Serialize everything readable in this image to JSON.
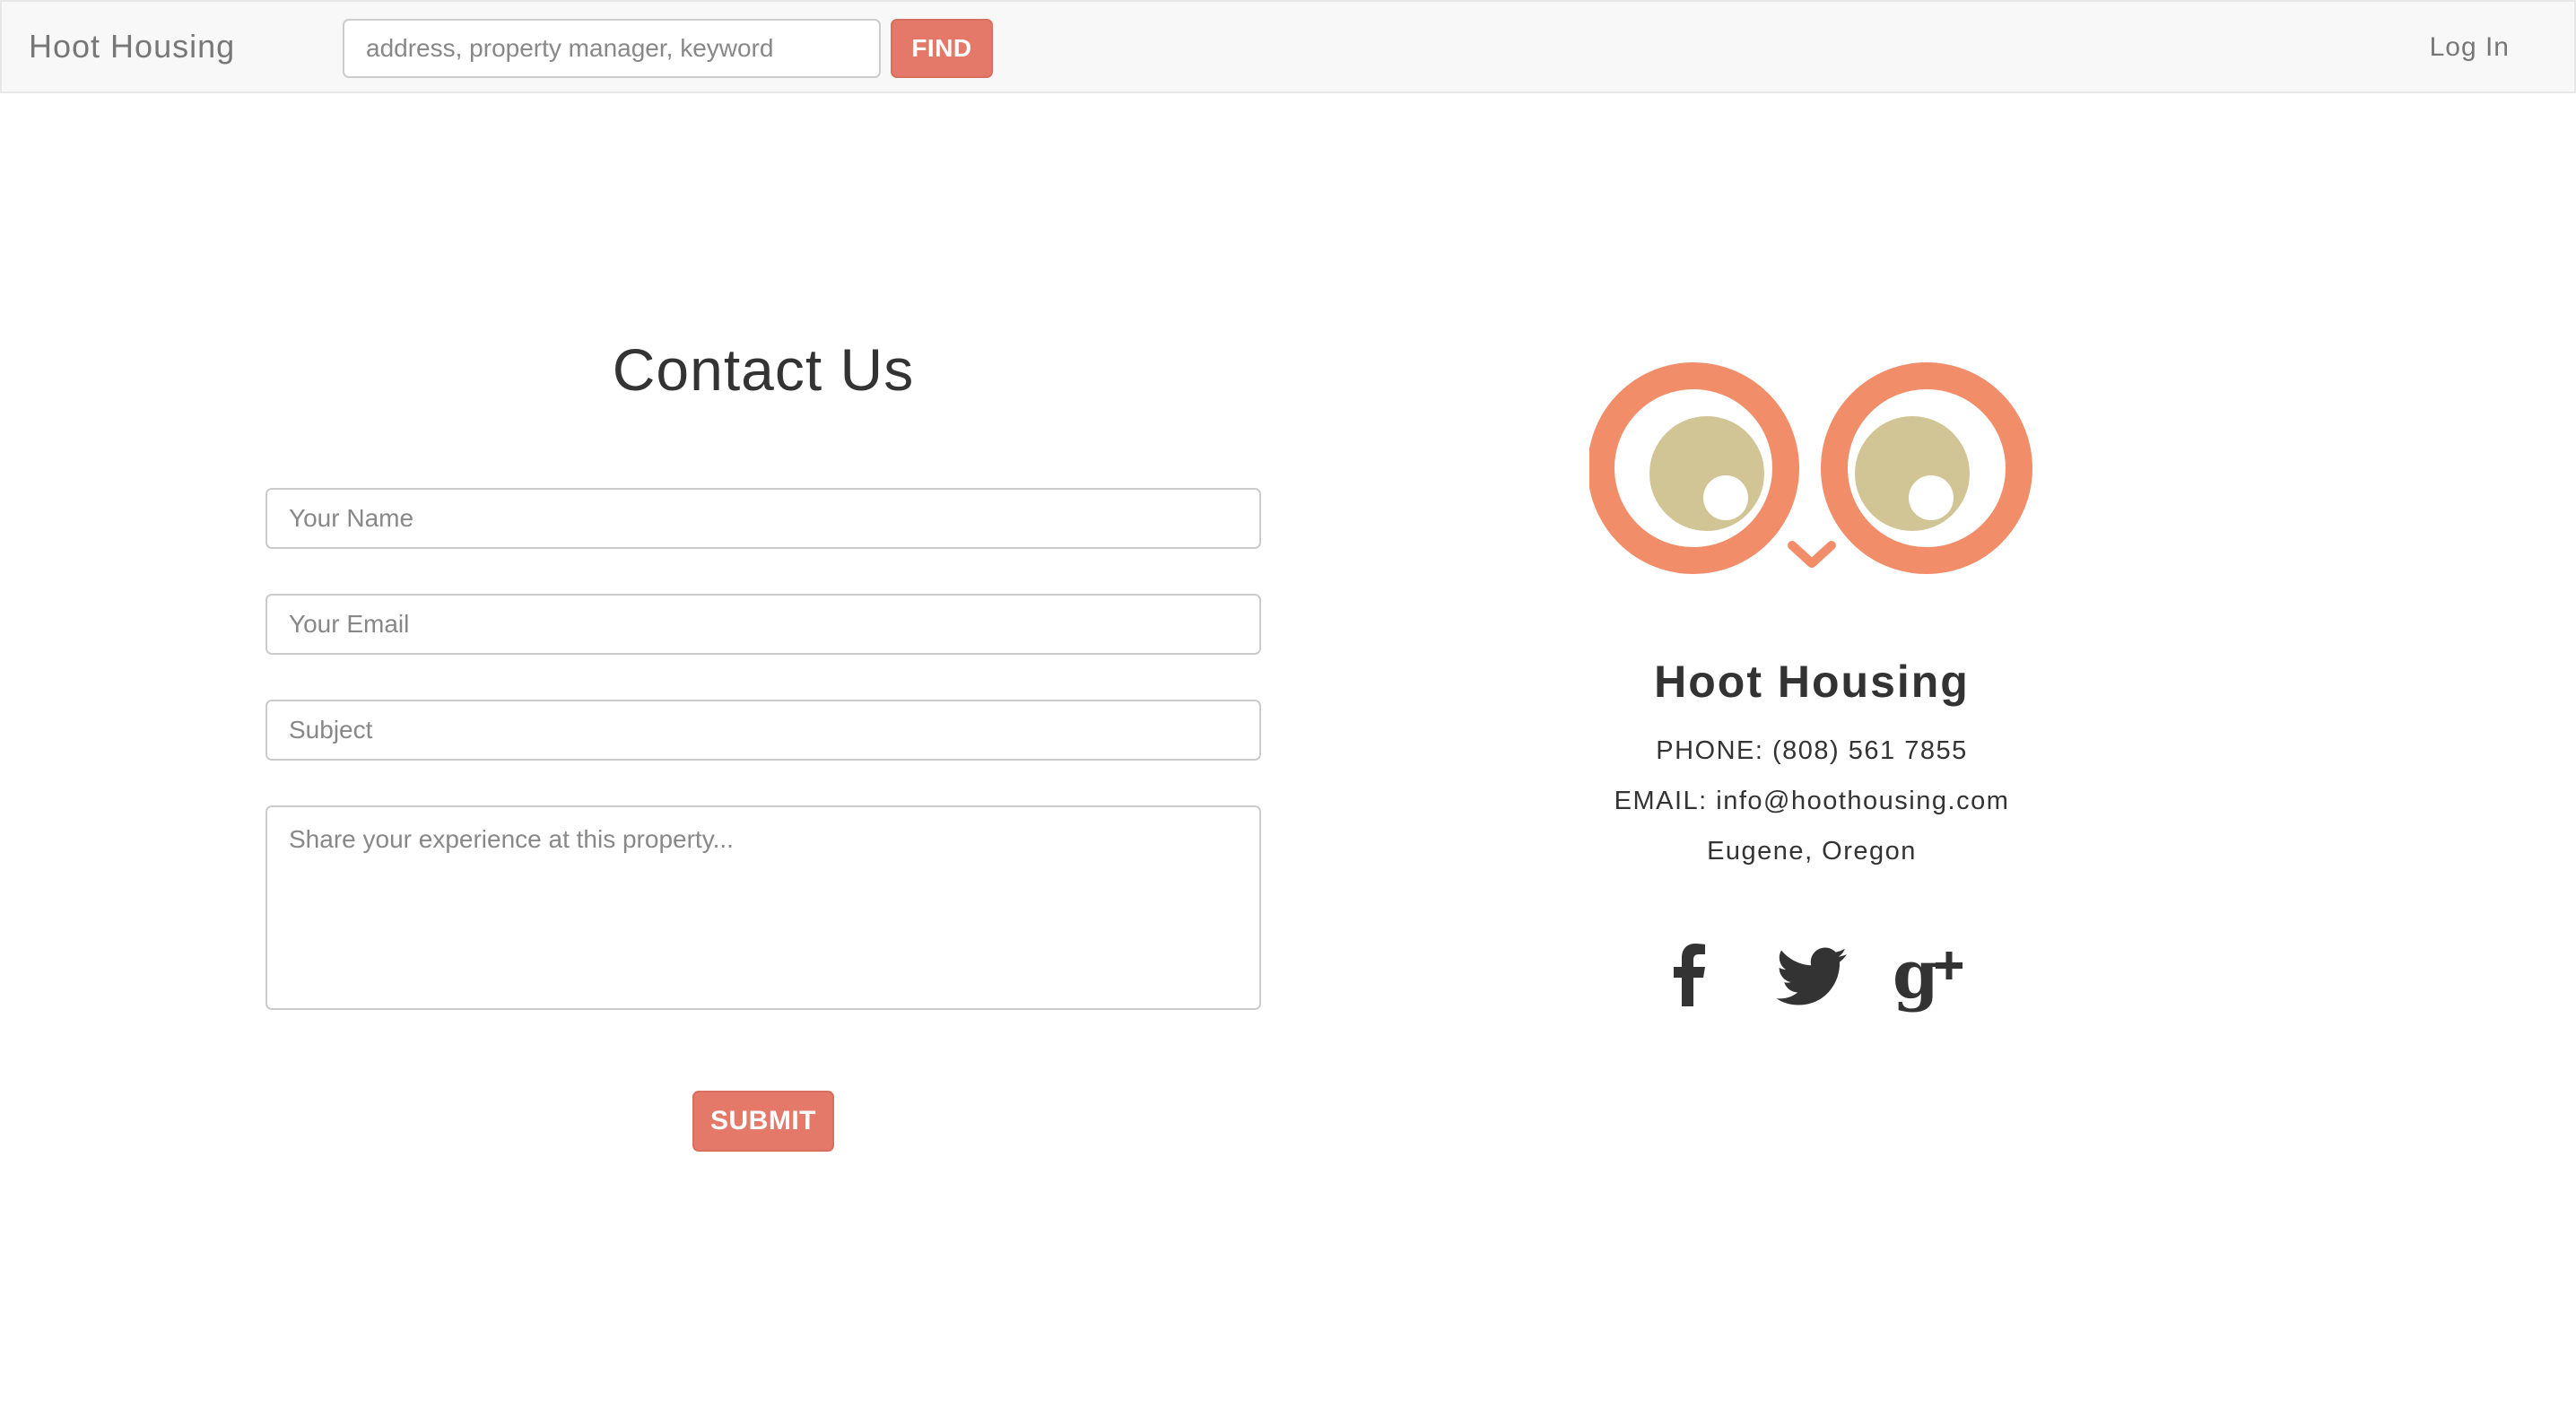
{
  "navbar": {
    "brand": "Hoot Housing",
    "search_placeholder": "address, property manager, keyword",
    "find_label": "FIND",
    "login_label": "Log In"
  },
  "contact_form": {
    "title": "Contact Us",
    "name_placeholder": "Your Name",
    "email_placeholder": "Your Email",
    "subject_placeholder": "Subject",
    "message_placeholder": "Share your experience at this property...",
    "submit_label": "SUBMIT"
  },
  "company": {
    "name": "Hoot Housing",
    "phone": "PHONE: (808) 561 7855",
    "email": "EMAIL: info@hoothousing.com",
    "location": "Eugene, Oregon"
  },
  "social": [
    {
      "icon": "facebook-icon"
    },
    {
      "icon": "twitter-icon"
    },
    {
      "icon": "google-plus-icon"
    }
  ],
  "colors": {
    "accent": "#e4796a",
    "logo_ring": "#f28d69",
    "logo_pupil": "#d1c596",
    "navbar_bg": "#f8f8f8",
    "icon_dark": "#333333"
  }
}
